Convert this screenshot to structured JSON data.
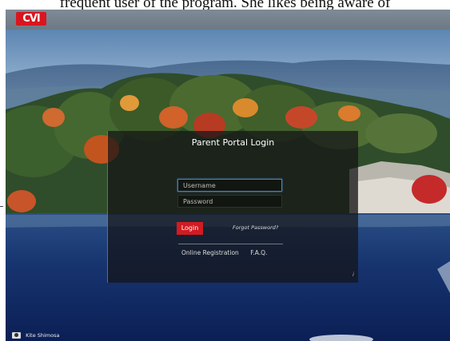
{
  "document": {
    "visible_text": "frequent user of the program. She likes being aware of"
  },
  "header": {
    "logo_text": "CVI",
    "logo_color": "#d9161f"
  },
  "login": {
    "title": "Parent Portal Login",
    "username_placeholder": "Username",
    "password_placeholder": "Password",
    "login_label": "Login",
    "forgot_label": "Forgot Password?",
    "links": [
      "Online Registration",
      "F.A.Q."
    ],
    "info_mark": "i",
    "accent_color": "#d11b22"
  },
  "background": {
    "credit_icon": "camera-icon",
    "credit_text": "Kite Shimosa"
  }
}
